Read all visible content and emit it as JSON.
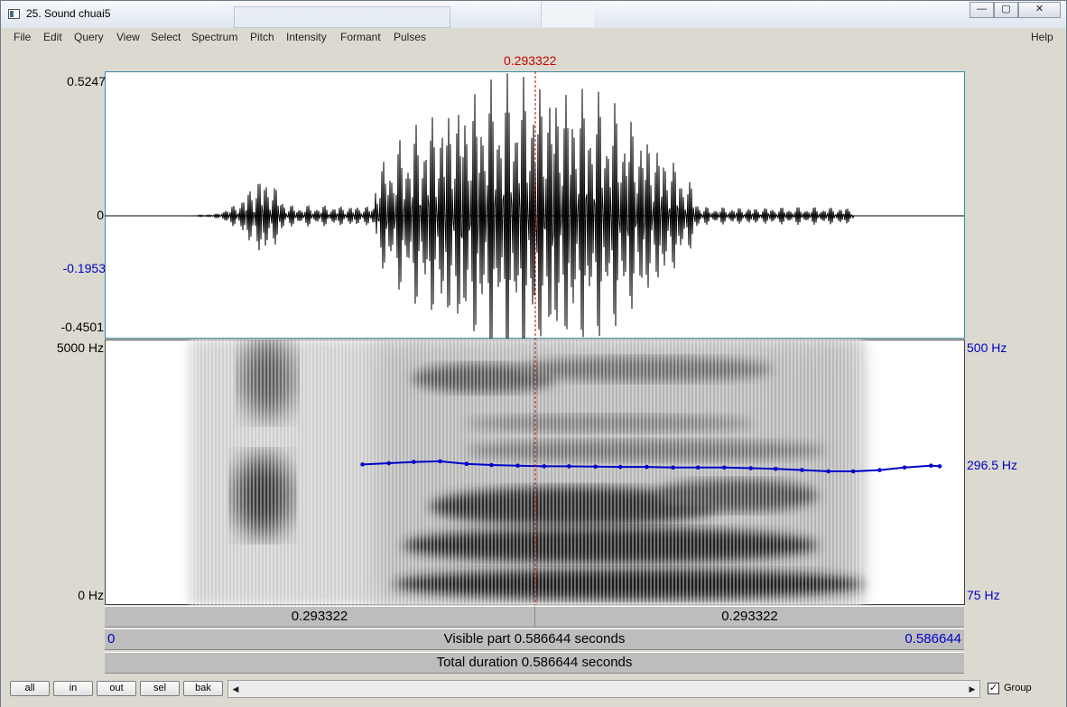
{
  "window": {
    "title": "25. Sound chuai5",
    "buttons": {
      "minimize": "—",
      "maximize": "▢",
      "close": "✕"
    }
  },
  "menu": [
    "File",
    "Edit",
    "Query",
    "View",
    "Select",
    "Spectrum",
    "Pitch",
    "Intensity",
    "Formant",
    "Pulses"
  ],
  "help_label": "Help",
  "cursor_label": "0.293322",
  "waveform": {
    "ymax_label": "0.5247",
    "zero_label": "0",
    "cursor_value_label": "-0.1953",
    "ymin_label": "-0.4501",
    "colors": {
      "frame": "#3a8bab",
      "wave": "#000000"
    }
  },
  "spectrogram": {
    "top_left_label": "5000 Hz",
    "bottom_left_label": "0 Hz",
    "pitch_top_label": "500 Hz",
    "pitch_mid_label": "296.5 Hz",
    "pitch_bottom_label": "75 Hz",
    "pitch_color": "#0000c8"
  },
  "time": {
    "left_segment": "0.293322",
    "right_segment": "0.293322",
    "start": "0",
    "end": "0.586644",
    "visible_part": "Visible part 0.586644 seconds",
    "total_duration": "Total duration 0.586644 seconds"
  },
  "toolbar": {
    "all": "all",
    "in": "in",
    "out": "out",
    "sel": "sel",
    "bak": "bak",
    "scroll_left": "◀",
    "scroll_right": "▶",
    "group_label": "Group",
    "group_checked": "✓"
  },
  "chart_data": {
    "type": "line",
    "x": [
      0.176,
      0.194,
      0.211,
      0.229,
      0.247,
      0.264,
      0.282,
      0.3,
      0.317,
      0.335,
      0.352,
      0.37,
      0.388,
      0.405,
      0.423,
      0.441,
      0.458,
      0.476,
      0.494,
      0.511,
      0.529,
      0.546,
      0.564,
      0.57
    ],
    "series": [
      {
        "values": [
          300,
          302,
          304,
          305,
          301,
          299,
          298,
          297,
          297,
          296.5,
          296,
          296,
          295,
          295,
          295,
          294,
          293,
          291,
          289,
          289,
          291,
          295,
          298,
          297
        ]
      }
    ],
    "xlim": [
      0,
      0.586644
    ],
    "ylim": [
      75,
      500
    ]
  }
}
